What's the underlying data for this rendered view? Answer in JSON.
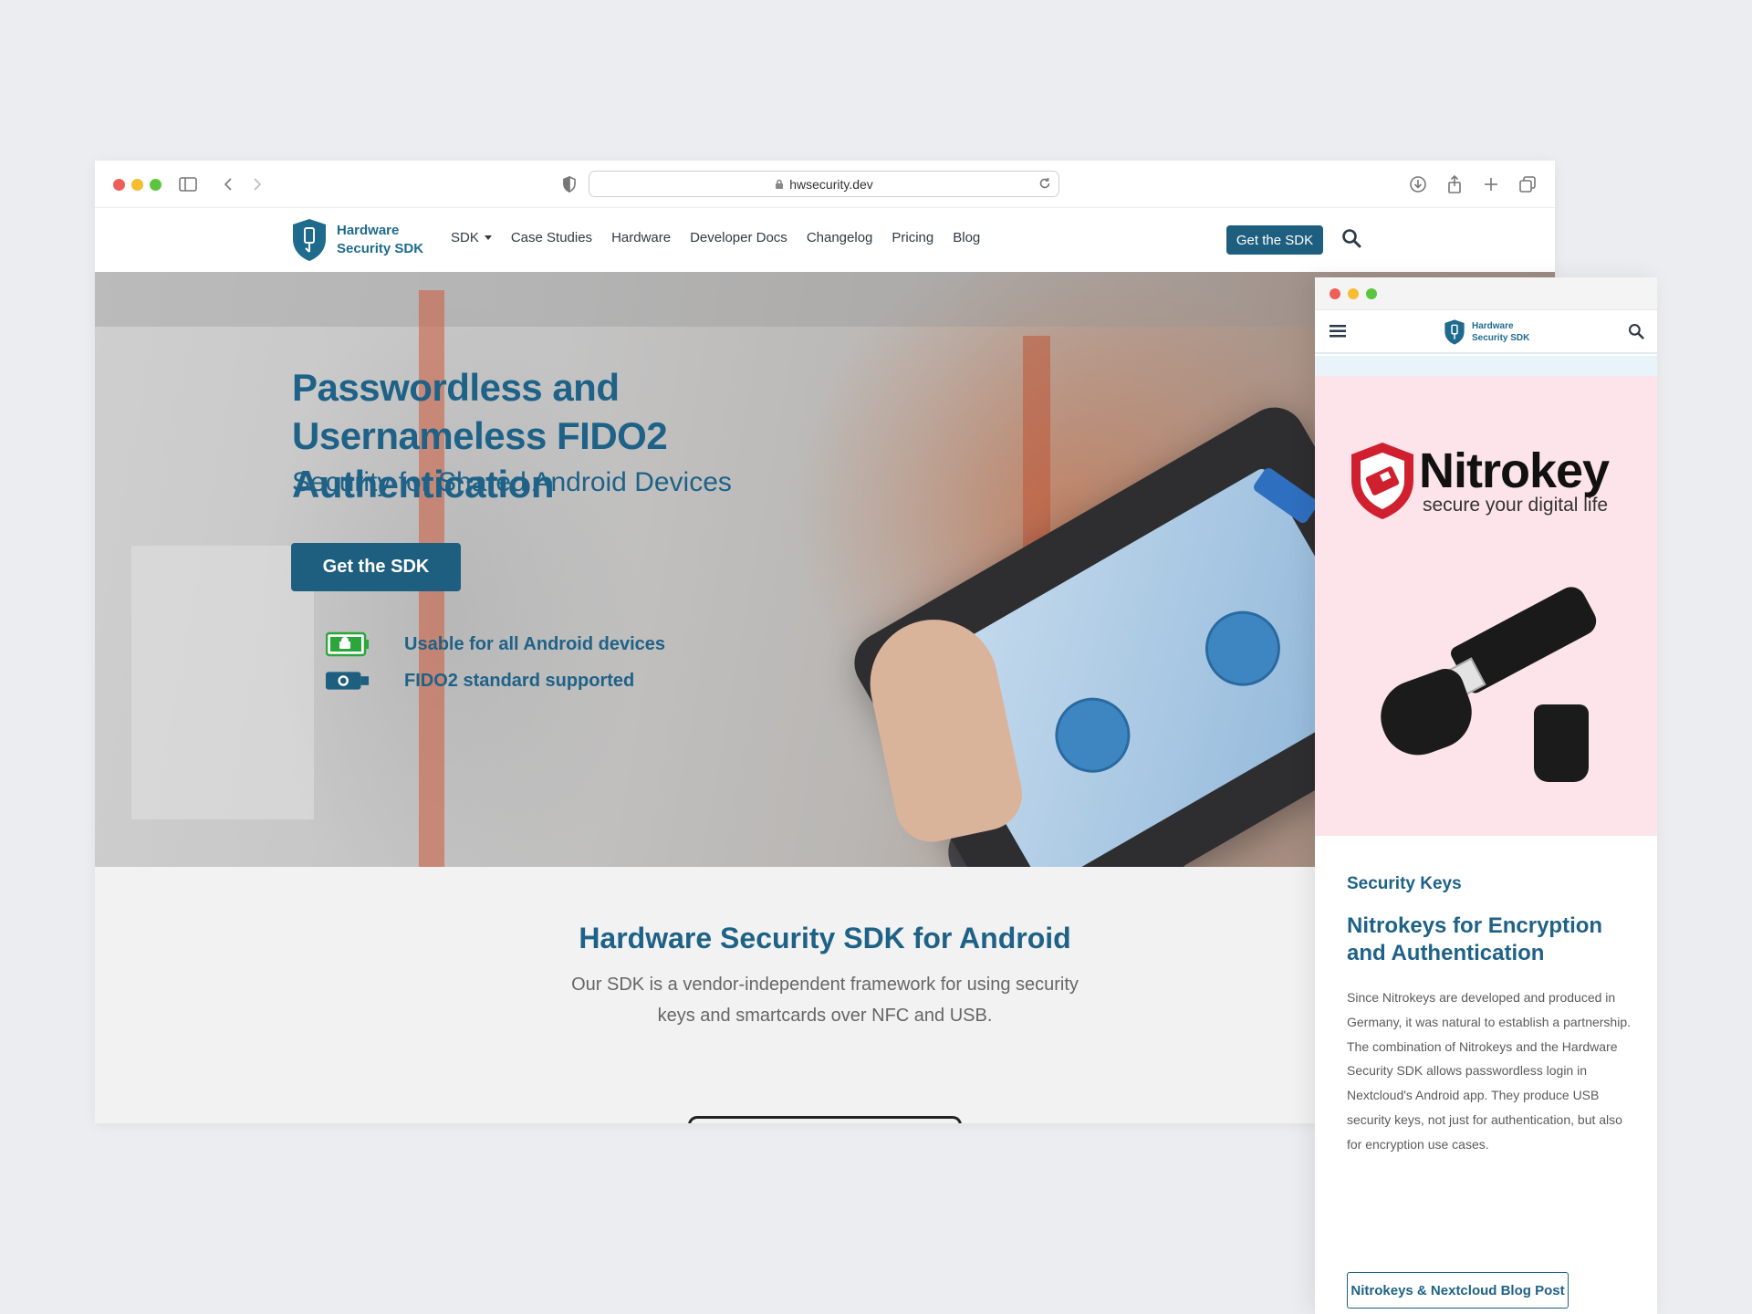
{
  "browser": {
    "url": "hwsecurity.dev"
  },
  "site": {
    "logo_line1": "Hardware",
    "logo_line2": "Security SDK",
    "nav": [
      {
        "label": "SDK"
      },
      {
        "label": "Case Studies"
      },
      {
        "label": "Hardware"
      },
      {
        "label": "Developer Docs"
      },
      {
        "label": "Changelog"
      },
      {
        "label": "Pricing"
      },
      {
        "label": "Blog"
      }
    ],
    "cta": "Get the SDK"
  },
  "hero": {
    "title": "Passwordless and Usernameless FIDO2 Authentication",
    "subtitle": "Security for Shared Android Devices",
    "cta": "Get the SDK",
    "features": [
      {
        "label": "Usable for all Android devices",
        "icon": "android-battery-icon"
      },
      {
        "label": "FIDO2 standard supported",
        "icon": "security-key-icon"
      }
    ]
  },
  "intro": {
    "title": "Hardware Security SDK for Android",
    "text": "Our SDK is a vendor-independent framework for using security keys and smartcards over NFC and USB."
  },
  "mobile": {
    "logo_line1": "Hardware",
    "logo_line2": "Security SDK",
    "brand_name": "Nitrokey",
    "brand_tagline": "secure your digital life",
    "kicker": "Security Keys",
    "title": "Nitrokeys for Encryption and Authentication",
    "text": "Since Nitrokeys are developed and produced in Germany, it was natural to establish a partnership. The combination of Nitrokeys and the Hardware Security SDK allows passwordless login in Nextcloud's Android app. They produce USB security keys, not just for authentication, but also for encryption use cases.",
    "button": "Nitrokeys & Nextcloud Blog Post"
  },
  "colors": {
    "brand": "#1f6287",
    "button": "#1e5f80",
    "nitrokey_red": "#d0202f",
    "image_bg": "#fde3ea"
  }
}
